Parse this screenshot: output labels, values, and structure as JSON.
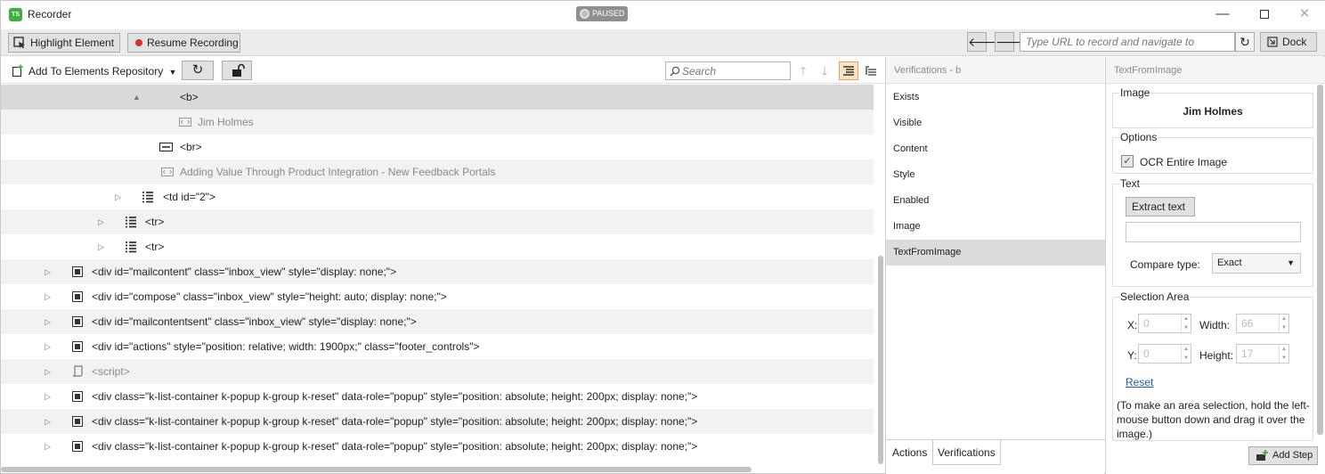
{
  "window": {
    "title": "Recorder",
    "logo_text": "TS"
  },
  "toolbar": {
    "highlight_label": "Highlight Element",
    "resume_label": "Resume Recording",
    "paused_label": "PAUSED",
    "url_placeholder": "Type URL to record and navigate to",
    "dock_label": "Dock"
  },
  "domtoolbar": {
    "add_repo_label": "Add To Elements Repository",
    "search_placeholder": "Search"
  },
  "tree": {
    "rows": [
      {
        "text": "<b>",
        "toggle": "▲"
      },
      {
        "text": "Jim Holmes"
      },
      {
        "text": "<br>"
      },
      {
        "text": "Adding Value Through Product Integration - New Feedback Portals"
      },
      {
        "text": "<td id=\"2\">",
        "toggle": "▷"
      },
      {
        "text": "<tr>",
        "toggle": "▷"
      },
      {
        "text": "<tr>",
        "toggle": "▷"
      },
      {
        "text": "<div id=\"mailcontent\" class=\"inbox_view\" style=\"display: none;\">",
        "toggle": "▷"
      },
      {
        "text": "<div id=\"compose\" class=\"inbox_view\" style=\"height: auto; display: none;\">",
        "toggle": "▷"
      },
      {
        "text": "<div id=\"mailcontentsent\" class=\"inbox_view\" style=\"display: none;\">",
        "toggle": "▷"
      },
      {
        "text": "<div id=\"actions\" style=\"position: relative; width: 1900px;\" class=\"footer_controls\">",
        "toggle": "▷"
      },
      {
        "text": "<script>",
        "toggle": "▷"
      },
      {
        "text": "<div class=\"k-list-container k-popup k-group k-reset\" data-role=\"popup\" style=\"position: absolute; height: 200px; display: none;\">",
        "toggle": "▷"
      },
      {
        "text": "<div class=\"k-list-container k-popup k-group k-reset\" data-role=\"popup\" style=\"position: absolute; height: 200px; display: none;\">",
        "toggle": "▷"
      },
      {
        "text": "<div class=\"k-list-container k-popup k-group k-reset\" data-role=\"popup\" style=\"position: absolute; height: 200px; display: none;\">",
        "toggle": "▷"
      }
    ]
  },
  "verifications": {
    "title": "Verifications - b",
    "items": [
      "Exists",
      "Visible",
      "Content",
      "Style",
      "Enabled",
      "Image",
      "TextFromImage"
    ],
    "selected": "TextFromImage",
    "tabs": [
      "Actions",
      "Verifications"
    ]
  },
  "details": {
    "title": "TextFromImage",
    "image_label": "Image",
    "image_text": "Jim Holmes",
    "options_label": "Options",
    "ocr_label": "OCR Entire Image",
    "ocr_checked": true,
    "text_label": "Text",
    "extract_label": "Extract text",
    "text_value": "",
    "compare_label": "Compare type:",
    "compare_value": "Exact",
    "selection_label": "Selection Area",
    "x_label": "X:",
    "x_value": "0",
    "y_label": "Y:",
    "y_value": "0",
    "width_label": "Width:",
    "width_value": "66",
    "height_label": "Height:",
    "height_value": "17",
    "reset_label": "Reset",
    "hint": "(To make an area selection, hold the left-mouse button down and drag it over the image.)",
    "add_step_label": "Add Step"
  },
  "colors": {
    "accent_green": "#3fae3f",
    "record_red": "#d9302c",
    "link_blue": "#1a5fb4",
    "selected_bg": "#d9d9d9"
  }
}
